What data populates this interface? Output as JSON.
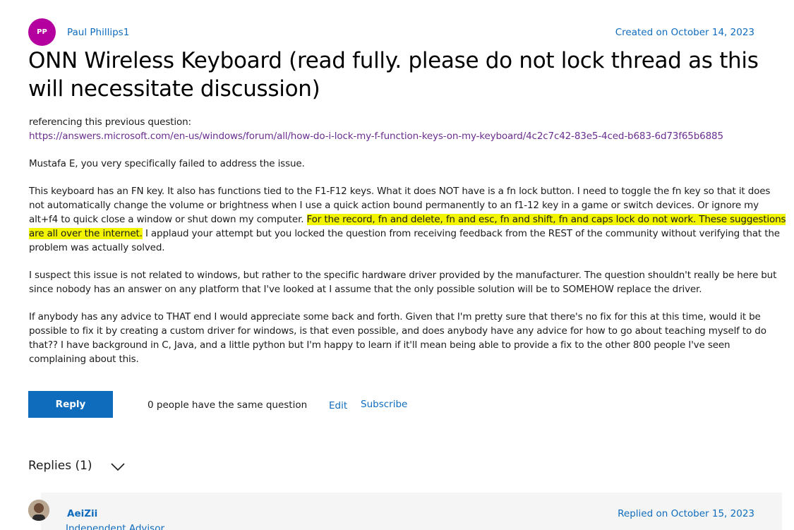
{
  "post": {
    "avatar_initials": "PP",
    "avatar_color": "#b4009e",
    "author": "Paul Phillips1",
    "created": "Created on October 14, 2023",
    "title": "ONN Wireless Keyboard (read fully. please do not lock thread as this will necessitate discussion)",
    "body": {
      "ref_intro": "referencing this previous question:",
      "ref_link": "https://answers.microsoft.com/en-us/windows/forum/all/how-do-i-lock-my-f-function-keys-on-my-keyboard/4c2c7c42-83e5-4ced-b683-6d73f65b6885",
      "p_mustafa": "Mustafa E, you very specifically failed to address the issue.",
      "p_keyboard_a": "This keyboard has an FN key.  It also has functions tied to the F1-F12 keys.  What it does NOT have is a fn lock button.  I need to toggle the fn key so that it does not automatically change the volume or brightness when I use a quick action bound permanently to an f1-12 key in a game or switch devices.  Or ignore my alt+f4 to quick close a window or shut down my computer.  ",
      "p_keyboard_highlight": "For the record, fn and delete, fn and esc, fn and shift, fn and caps lock do not work.  These suggestions are all over the internet.",
      "p_keyboard_b": "  I applaud your attempt but you locked the question from receiving feedback from the REST of the community without verifying that the problem was actually solved.",
      "p_suspect": "I suspect this issue is not related to windows, but rather to the specific hardware driver provided by the manufacturer.  The question shouldn't really be here but since nobody has an answer on any platform that I've looked at I assume that the only possible solution will be to SOMEHOW replace the driver.",
      "p_advice": "If anybody has any advice to THAT end I would appreciate some back and forth.  Given that I'm pretty sure that there's no fix for this at this time, would it be possible to fix it by creating a custom driver for windows, is that even possible, and does anybody have any advice for how to go about teaching myself to do that??  I have background in C, Java, and a little python but I'm happy to learn if it'll mean being able to provide a fix to the other 800 people I've seen complaining about this."
    },
    "highlight_color": "#f3f500"
  },
  "actions": {
    "reply_label": "Reply",
    "same_question": "0 people have the same question",
    "edit_label": "Edit",
    "subscribe_label": "Subscribe"
  },
  "replies": {
    "header": "Replies (1)",
    "first": {
      "author": "AeiZii",
      "role": "Independent Advisor",
      "replied": "Replied on October 15, 2023"
    }
  },
  "colors": {
    "link_blue": "#0f6cbd",
    "visited_link": "#6b2e8f"
  }
}
